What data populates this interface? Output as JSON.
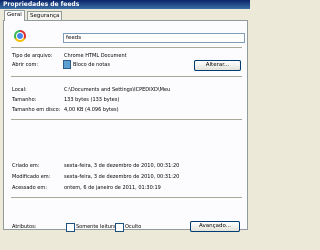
{
  "window": {
    "title": "Propriedades de feeds"
  },
  "tabs": [
    {
      "label": "Geral"
    },
    {
      "label": "Segurança"
    }
  ],
  "filename": {
    "value": "feeds"
  },
  "rows": {
    "type": {
      "label": "Tipo de arquivo:",
      "value": "Chrome HTML Document"
    },
    "opens_with": {
      "label": "Abrir com:",
      "value": "Bloco de notas",
      "button": "Alterar..."
    },
    "location": {
      "label": "Local:",
      "value": "C:\\Documents and Settings\\ICPEDIXD\\Meu"
    },
    "size": {
      "label": "Tamanho:",
      "value": "133 bytes (133 bytes)"
    },
    "size_on_disk": {
      "label": "Tamanho em disco:",
      "value": "4,00 KB (4.096 bytes)"
    },
    "created": {
      "label": "Criado em:",
      "value": "sexta-feira, 3 de dezembro de 2010, 00:31:20"
    },
    "modified": {
      "label": "Modificado em:",
      "value": "sexta-feira, 3 de dezembro de 2010, 00:31:20"
    },
    "accessed": {
      "label": "Acessado em:",
      "value": "ontem, 6 de janeiro de 2011, 01:30:19"
    }
  },
  "attributes": {
    "label": "Atributos:",
    "readonly": {
      "label": "Somente leitura",
      "checked": false
    },
    "hidden": {
      "label": "Oculto",
      "checked": false
    },
    "advanced_button": "Avançado..."
  },
  "colors": {
    "titlebar": "#0a246a",
    "panel": "#fcfcfe",
    "chrome_bg": "#ece9d8"
  }
}
